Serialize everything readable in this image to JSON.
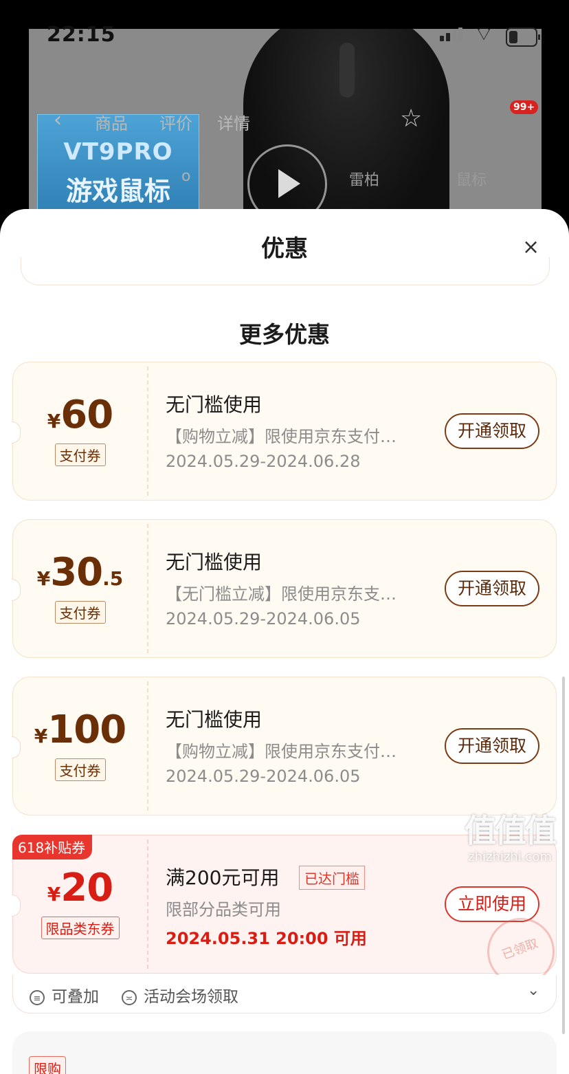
{
  "status_bar": {
    "time": "22:15"
  },
  "background": {
    "card_line1": "VT9PRO",
    "card_line2": "游戏鼠标",
    "tabs": [
      "商品",
      "评价",
      "详情"
    ],
    "badge": "99+",
    "sub_labels": [
      "雷柏",
      "鼠标"
    ],
    "partial_label": "o"
  },
  "sheet": {
    "title": "优惠",
    "close_symbol": "×",
    "section_title": "更多优惠"
  },
  "coupons": [
    {
      "currency": "¥",
      "amount": "60",
      "decimal": "",
      "type": "支付券",
      "title": "无门槛使用",
      "desc": "【购物立减】限使用京东支付…",
      "date": "2024.05.29-2024.06.28",
      "button": "开通领取"
    },
    {
      "currency": "¥",
      "amount": "30",
      "decimal": ".5",
      "type": "支付券",
      "title": "无门槛使用",
      "desc": "【无门槛立减】限使用京东支…",
      "date": "2024.05.29-2024.06.05",
      "button": "开通领取"
    },
    {
      "currency": "¥",
      "amount": "100",
      "decimal": "",
      "type": "支付券",
      "title": "无门槛使用",
      "desc": "【购物立减】限使用京东支付…",
      "date": "2024.05.29-2024.06.05",
      "button": "开通领取"
    },
    {
      "badge": "618补贴券",
      "currency": "¥",
      "amount": "20",
      "decimal": "",
      "type": "限品类东券",
      "title": "满200元可用",
      "reached": "已达门槛",
      "desc": "限部分品类可用",
      "date": "2024.05.31 20:00 可用",
      "button": "立即使用",
      "stamp": "已领取"
    }
  ],
  "card_footer": {
    "stackable_icon": "≡",
    "stackable": "可叠加",
    "venue_icon": "≍",
    "venue": "活动会场领取",
    "chevron": "⌄"
  },
  "next_card": {
    "tag": "限购"
  },
  "watermark": {
    "big": "值值值",
    "small": "zhizhizhi.com"
  },
  "colors": {
    "accent_brown": "#6b2f08",
    "accent_red": "#d81e14",
    "coupon_bg": "#fffaf2",
    "coupon_red_bg": "#fff3f1"
  }
}
